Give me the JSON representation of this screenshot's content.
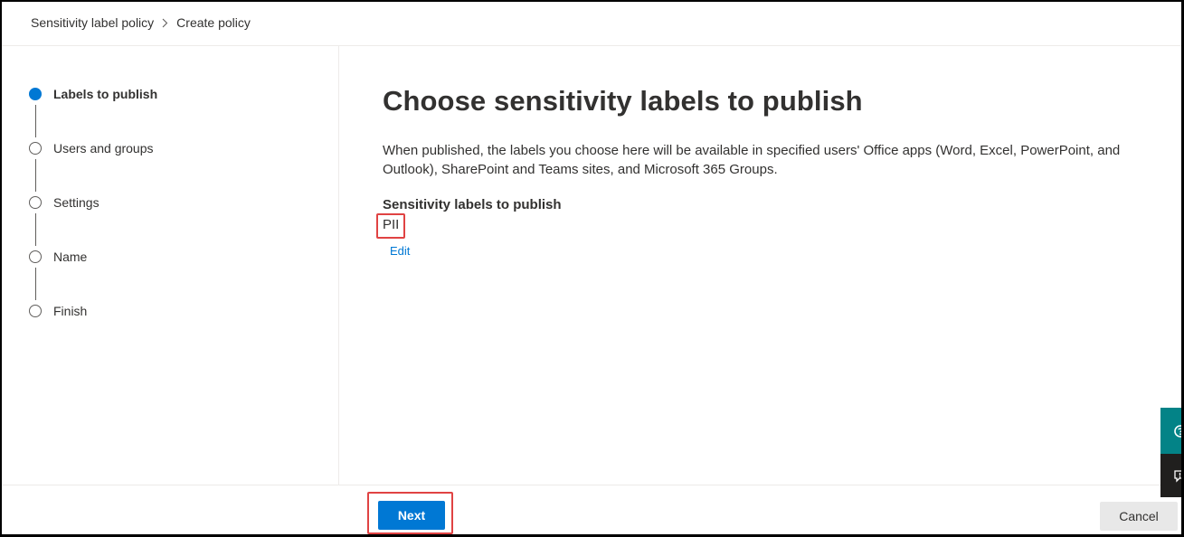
{
  "breadcrumb": {
    "items": [
      "Sensitivity label policy",
      "Create policy"
    ],
    "separator_icon": "chevron-right-icon"
  },
  "stepper": {
    "steps": [
      {
        "label": "Labels to publish",
        "state": "current"
      },
      {
        "label": "Users and groups",
        "state": "pending"
      },
      {
        "label": "Settings",
        "state": "pending"
      },
      {
        "label": "Name",
        "state": "pending"
      },
      {
        "label": "Finish",
        "state": "pending"
      }
    ]
  },
  "main": {
    "title": "Choose sensitivity labels to publish",
    "description": "When published, the labels you choose here will be available in specified users' Office apps (Word, Excel, PowerPoint, and Outlook), SharePoint and Teams sites, and Microsoft 365 Groups.",
    "section_title": "Sensitivity labels to publish",
    "labels_value": "PII",
    "edit_link": "Edit"
  },
  "floating": {
    "top_icon": "help-icon",
    "bottom_icon": "feedback-icon"
  },
  "footer": {
    "next_label": "Next",
    "cancel_label": "Cancel"
  },
  "colors": {
    "accent": "#0078d4",
    "highlight": "#e04343",
    "teal": "#038387",
    "dark": "#201f1e"
  }
}
